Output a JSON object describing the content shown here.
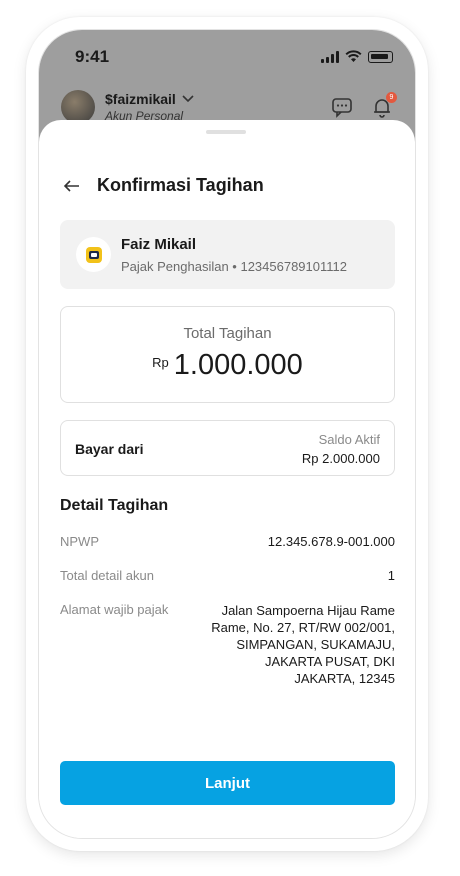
{
  "status_bar": {
    "time": "9:41"
  },
  "header": {
    "username": "$faizmikail",
    "account_type": "Akun Personal",
    "notification_count": "9"
  },
  "sheet": {
    "title": "Konfirmasi Tagihan",
    "payee": {
      "name": "Faiz Mikail",
      "subtitle": "Pajak Penghasilan • 123456789101112"
    },
    "total": {
      "label": "Total Tagihan",
      "currency": "Rp",
      "amount": "1.000.000"
    },
    "pay_from": {
      "label": "Bayar dari",
      "balance_label": "Saldo Aktif",
      "balance_value": "Rp 2.000.000"
    },
    "details": {
      "title": "Detail Tagihan",
      "rows": [
        {
          "label": "NPWP",
          "value": "12.345.678.9-001.000"
        },
        {
          "label": "Total detail akun",
          "value": "1"
        },
        {
          "label": "Alamat wajib pajak",
          "value": "Jalan Sampoerna Hijau Rame Rame, No. 27, RT/RW 002/001, SIMPANGAN, SUKAMAJU, JAKARTA PUSAT, DKI JAKARTA, 12345"
        }
      ]
    },
    "cta_label": "Lanjut"
  },
  "colors": {
    "accent": "#06a2e2",
    "badge": "#e3593f",
    "logo_yellow": "#f2c21a",
    "logo_navy": "#1e2a4a"
  },
  "icons": [
    "signal-icon",
    "wifi-icon",
    "battery-icon",
    "chat-icon",
    "bell-icon",
    "back-arrow-icon",
    "chevron-down-icon"
  ]
}
